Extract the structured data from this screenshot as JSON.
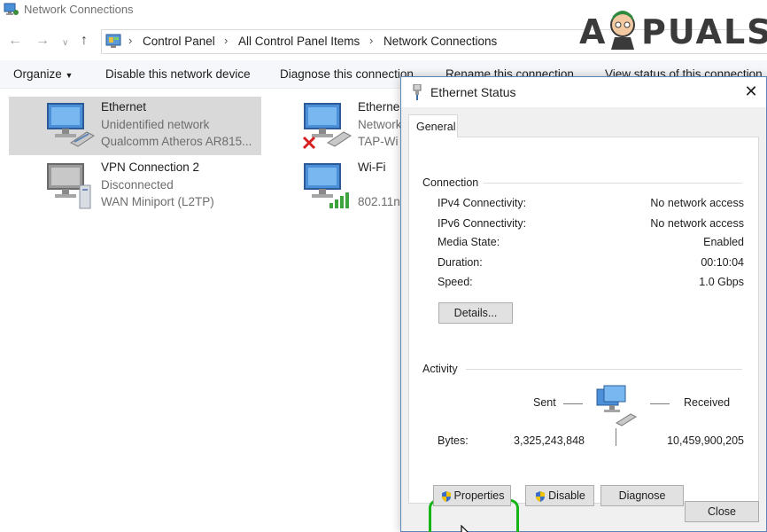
{
  "window": {
    "title": "Network Connections"
  },
  "address": {
    "breadcrumbs": [
      "Control Panel",
      "All Control Panel Items",
      "Network Connections"
    ]
  },
  "commands": [
    "Organize",
    "Disable this network device",
    "Diagnose this connection",
    "Rename this connection",
    "View status of this connection"
  ],
  "connections": [
    {
      "name": "Ethernet",
      "status": "Unidentified network",
      "adapter": "Qualcomm Atheros AR815..."
    },
    {
      "name": "Etherne",
      "status": "Network",
      "adapter": "TAP-Wi"
    },
    {
      "name": "VPN Connection 2",
      "status": "Disconnected",
      "adapter": "WAN Miniport (L2TP)"
    },
    {
      "name": "Wi-Fi",
      "status": "",
      "adapter": "802.11n"
    }
  ],
  "dialog": {
    "title": "Ethernet Status",
    "tab": "General",
    "connection_group": "Connection",
    "fields": [
      {
        "label": "IPv4 Connectivity:",
        "value": "No network access"
      },
      {
        "label": "IPv6 Connectivity:",
        "value": "No network access"
      },
      {
        "label": "Media State:",
        "value": "Enabled"
      },
      {
        "label": "Duration:",
        "value": "00:10:04"
      },
      {
        "label": "Speed:",
        "value": "1.0 Gbps"
      }
    ],
    "details_button": "Details...",
    "activity_group": "Activity",
    "sent_label": "Sent",
    "received_label": "Received",
    "bytes_label": "Bytes:",
    "bytes_sent": "3,325,243,848",
    "bytes_received": "10,459,900,205",
    "properties_button": "Properties",
    "disable_button": "Disable",
    "diagnose_button": "Diagnose",
    "close_button": "Close"
  },
  "watermark": {
    "text_left": "A",
    "text_right": "PUALS"
  },
  "colors": {
    "selection": "#d9d9d9",
    "highlight": "#15b515",
    "accent": "#5c86b8"
  }
}
